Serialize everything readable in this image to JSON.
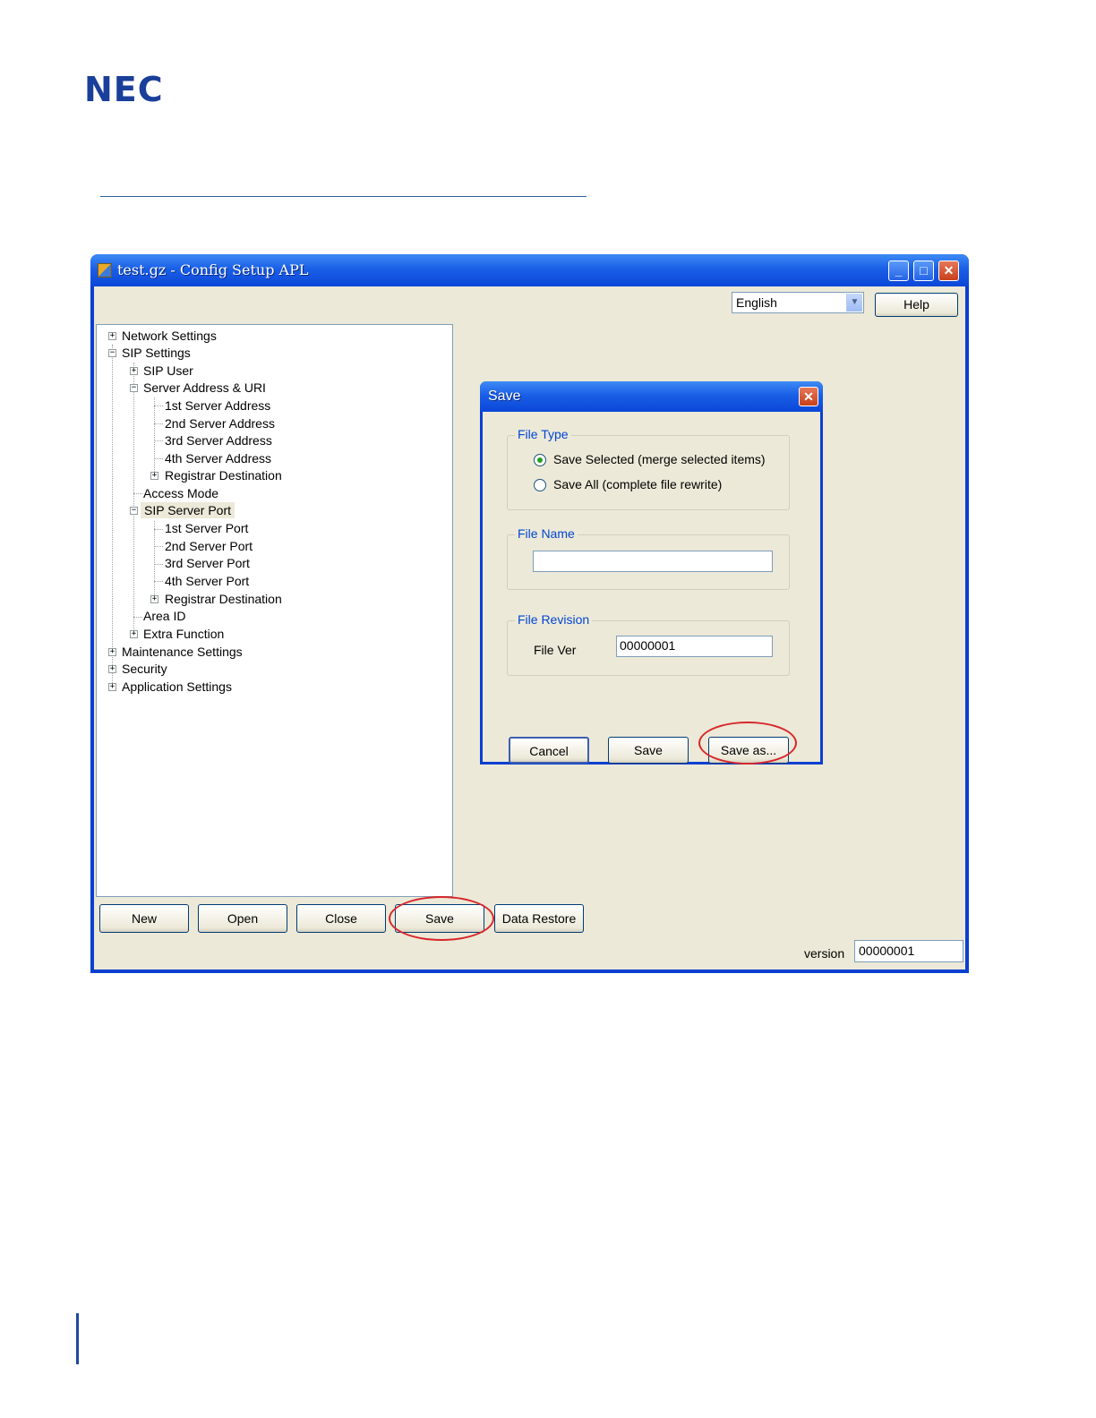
{
  "logo": "NEC",
  "window": {
    "title": "test.gz - Config Setup APL",
    "language": "English",
    "help_label": "Help",
    "controls": [
      "_",
      "□",
      "✕"
    ]
  },
  "tree": [
    {
      "label": "Network Settings",
      "expander": "+"
    },
    {
      "label": "SIP Settings",
      "expander": "−"
    },
    {
      "label": "SIP User",
      "expander": "+"
    },
    {
      "label": "Server Address & URI",
      "expander": "−"
    },
    {
      "label": "1st Server Address"
    },
    {
      "label": "2nd Server Address"
    },
    {
      "label": "3rd Server Address"
    },
    {
      "label": "4th Server Address"
    },
    {
      "label": "Registrar Destination",
      "expander": "+"
    },
    {
      "label": "Access Mode"
    },
    {
      "label": "SIP Server Port",
      "expander": "−",
      "selected": true
    },
    {
      "label": "1st Server Port"
    },
    {
      "label": "2nd Server Port"
    },
    {
      "label": "3rd Server Port"
    },
    {
      "label": "4th Server Port"
    },
    {
      "label": "Registrar Destination",
      "expander": "+"
    },
    {
      "label": "Area ID"
    },
    {
      "label": "Extra Function",
      "expander": "+"
    },
    {
      "label": "Maintenance Settings",
      "expander": "+"
    },
    {
      "label": "Security",
      "expander": "+"
    },
    {
      "label": "Application Settings",
      "expander": "+"
    }
  ],
  "bottom_buttons": {
    "new": "New",
    "open": "Open",
    "close": "Close",
    "save": "Save",
    "data_restore": "Data Restore"
  },
  "version": {
    "label": "version",
    "value": "00000001"
  },
  "dialog": {
    "title": "Save",
    "file_type": {
      "label": "File Type",
      "option_selected": "Save Selected (merge selected items)",
      "option_all": "Save All (complete file rewrite)"
    },
    "file_name": {
      "label": "File Name",
      "value": ""
    },
    "file_revision": {
      "label": "File Revision",
      "field_label": "File Ver",
      "value": "00000001"
    },
    "buttons": {
      "cancel": "Cancel",
      "save": "Save",
      "save_as": "Save as..."
    }
  },
  "colors": {
    "window_frame": "#0a3fd0",
    "dialog_face": "#ece9d8",
    "group_label": "#0046d5",
    "highlight_ring": "#d8262a",
    "brand": "#1a3f9a"
  }
}
